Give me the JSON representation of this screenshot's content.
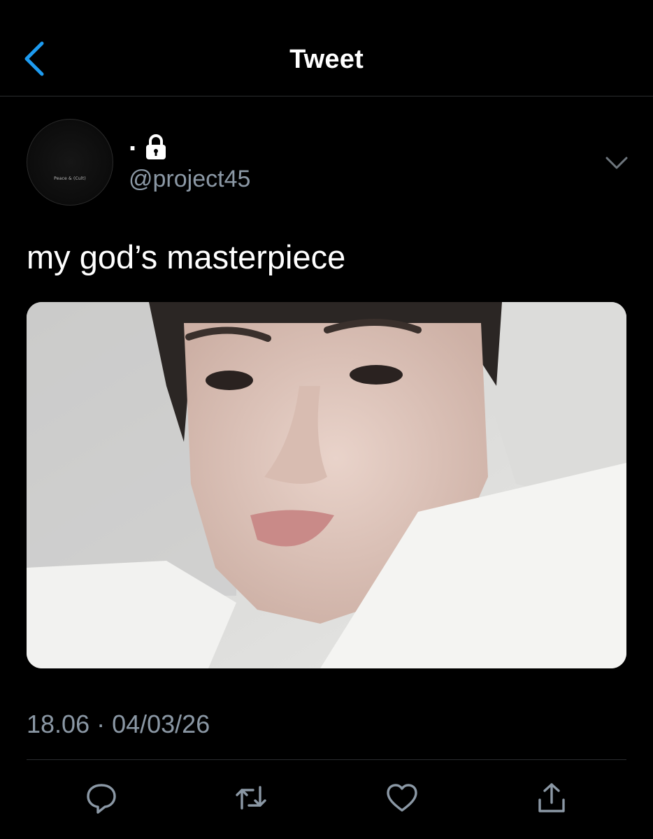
{
  "header": {
    "title": "Tweet",
    "back_icon": "chevron-left-icon"
  },
  "author": {
    "display_name": ".",
    "protected_icon": "lock-icon",
    "handle": "@project45",
    "avatar_text": "Peace & (Cult)"
  },
  "tweet": {
    "text": "my god’s masterpiece",
    "media_icon": "photo"
  },
  "meta": {
    "timestamp": "18.06 · 04/03/26"
  },
  "actions": {
    "reply_icon": "reply-icon",
    "retweet_icon": "retweet-icon",
    "like_icon": "heart-icon",
    "share_icon": "share-icon"
  },
  "colors": {
    "background": "#000000",
    "text": "#ffffff",
    "secondary_text": "#8b98a5",
    "accent": "#1d9bf0",
    "divider": "#2a2d30"
  }
}
